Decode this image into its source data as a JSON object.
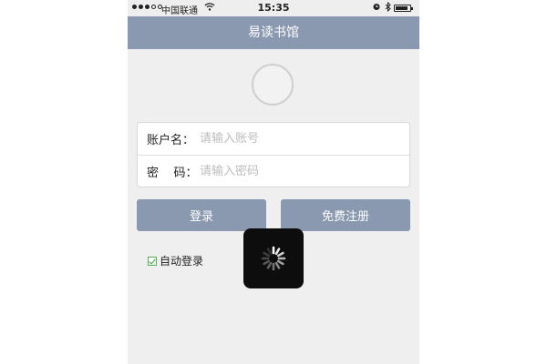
{
  "status_bar": {
    "carrier": "中国联通",
    "time": "15:35",
    "wifi_icon": "wifi-icon",
    "alarm_icon": "alarm-icon",
    "bluetooth_icon": "bluetooth-icon",
    "battery_level": 0.85
  },
  "navbar": {
    "title": "易读书馆"
  },
  "form": {
    "account_label": "账户名：",
    "account_placeholder": "请输入账号",
    "password_label": "密    码：",
    "password_placeholder": "请输入密码"
  },
  "buttons": {
    "login": "登录",
    "register": "免费注册"
  },
  "auto_login": {
    "label": "自动登录",
    "checked": true
  },
  "colors": {
    "accent": "#8a98b0",
    "background": "#efefef",
    "check": "#3aa03a"
  }
}
